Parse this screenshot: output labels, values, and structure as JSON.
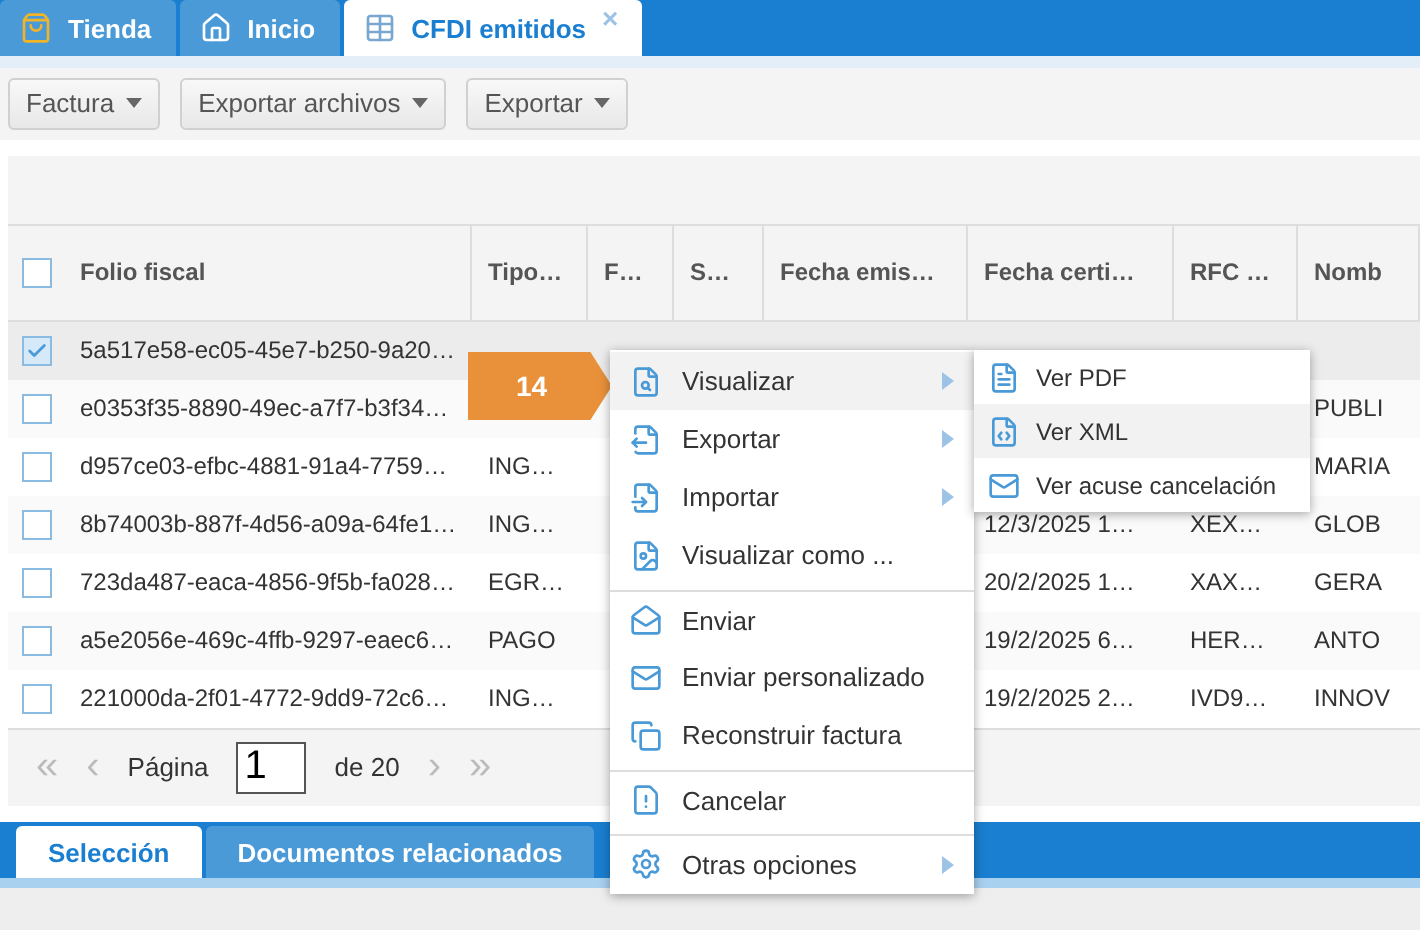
{
  "tabs": [
    {
      "label": "Tienda",
      "selected": false,
      "closable": false
    },
    {
      "label": "Inicio",
      "selected": false,
      "closable": false
    },
    {
      "label": "CFDI emitidos",
      "selected": true,
      "closable": true,
      "close_glyph": "×"
    }
  ],
  "toolbar": [
    {
      "label": "Factura"
    },
    {
      "label": "Exportar archivos"
    },
    {
      "label": "Exportar"
    }
  ],
  "table": {
    "columns": [
      "Folio fiscal",
      "Tipo…",
      "F…",
      "S…",
      "Fecha emis…",
      "Fecha certi…",
      "RFC …",
      "Nomb"
    ],
    "header_checked": false,
    "rows": [
      {
        "checked": true,
        "selected": true,
        "cells": [
          "5a517e58-ec05-45e7-b250-9a20…",
          null,
          null,
          null,
          null,
          null,
          null,
          null
        ]
      },
      {
        "checked": false,
        "selected": false,
        "cells": [
          "e0353f35-8890-49ec-a7f7-b3f34…",
          null,
          null,
          null,
          null,
          null,
          null,
          "PUBLI"
        ]
      },
      {
        "checked": false,
        "selected": false,
        "cells": [
          "d957ce03-efbc-4881-91a4-7759…",
          "ING…",
          null,
          null,
          null,
          null,
          null,
          "MARIA"
        ]
      },
      {
        "checked": false,
        "selected": false,
        "cells": [
          "8b74003b-887f-4d56-a09a-64fe1…",
          "ING…",
          null,
          null,
          null,
          "12/3/2025 1…",
          "XEX…",
          "GLOB"
        ]
      },
      {
        "checked": false,
        "selected": false,
        "cells": [
          "723da487-eaca-4856-9f5b-fa028…",
          "EGR…",
          null,
          null,
          null,
          "20/2/2025 1…",
          "XAX…",
          "GERA"
        ]
      },
      {
        "checked": false,
        "selected": false,
        "cells": [
          "a5e2056e-469c-4ffb-9297-eaec6…",
          "PAGO",
          null,
          null,
          null,
          "19/2/2025 6…",
          "HER…",
          "ANTO"
        ]
      },
      {
        "checked": false,
        "selected": false,
        "cells": [
          "221000da-2f01-4772-9dd9-72c6…",
          "ING…",
          null,
          null,
          null,
          "19/2/2025 2…",
          "IVD9…",
          "INNOV"
        ]
      }
    ]
  },
  "pager": {
    "first": "«",
    "prev": "‹",
    "label": "Página",
    "page": "1",
    "of": "de 20",
    "next": "›",
    "last": "»"
  },
  "bottom_tabs": [
    {
      "label": "Selección",
      "selected": true
    },
    {
      "label": "Documentos relacionados",
      "selected": false
    }
  ],
  "step_badge": "14",
  "context_menu": [
    {
      "label": "Visualizar",
      "has_submenu": true,
      "selected": true,
      "separator_before": false
    },
    {
      "label": "Exportar",
      "has_submenu": true,
      "selected": false,
      "separator_before": false
    },
    {
      "label": "Importar",
      "has_submenu": true,
      "selected": false,
      "separator_before": false
    },
    {
      "label": "Visualizar como ...",
      "has_submenu": false,
      "selected": false,
      "separator_before": false
    },
    {
      "label": "Enviar",
      "has_submenu": false,
      "selected": false,
      "separator_before": true
    },
    {
      "label": "Enviar personalizado",
      "has_submenu": false,
      "selected": false,
      "separator_before": false
    },
    {
      "label": "Reconstruir factura",
      "has_submenu": false,
      "selected": false,
      "separator_before": false
    },
    {
      "label": "Cancelar",
      "has_submenu": false,
      "selected": false,
      "separator_before": true
    },
    {
      "label": "Otras opciones",
      "has_submenu": true,
      "selected": false,
      "separator_before": true
    }
  ],
  "submenu": [
    {
      "label": "Ver PDF",
      "selected": false
    },
    {
      "label": "Ver XML",
      "selected": true
    },
    {
      "label": "Ver acuse cancelación",
      "selected": false
    }
  ]
}
